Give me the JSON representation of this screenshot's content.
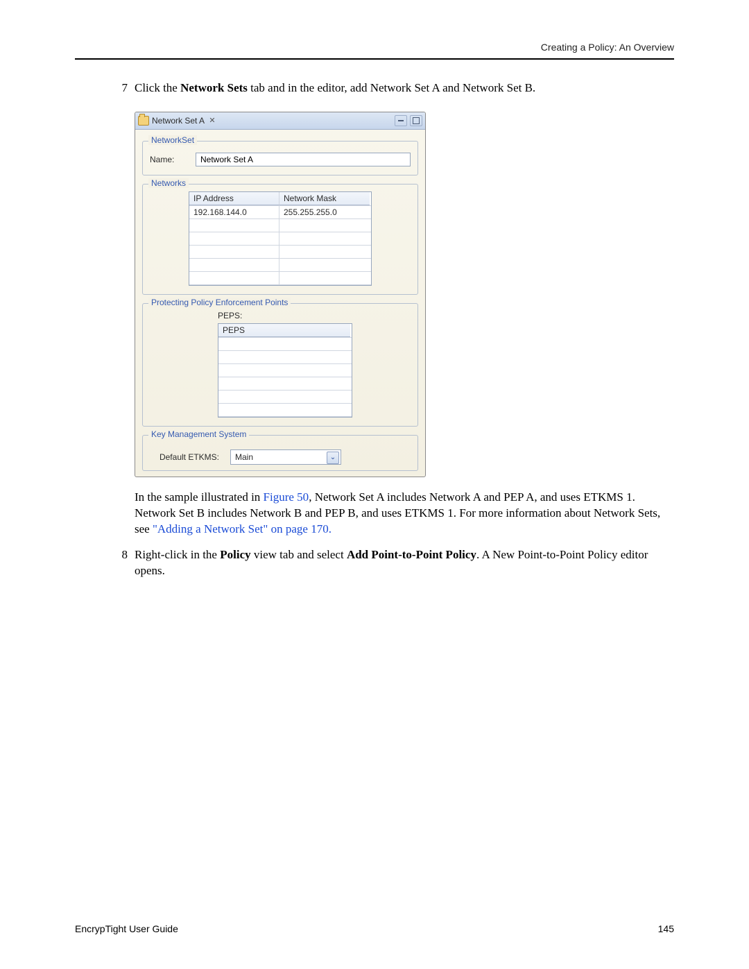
{
  "header": {
    "running_head": "Creating a Policy: An Overview"
  },
  "steps": {
    "seven": {
      "marker": "7",
      "prefix": "Click the ",
      "bold": "Network Sets",
      "suffix": " tab and in the editor, add Network Set A and Network Set B."
    },
    "eight": {
      "marker": "8",
      "prefix": "Right-click in the ",
      "bold1": "Policy",
      "mid": " view tab and select ",
      "bold2": "Add Point-to-Point Policy",
      "suffix": ". A New Point-to-Point Policy editor opens."
    }
  },
  "paragraph": {
    "prefix": "In the sample illustrated in ",
    "link1": "Figure 50",
    "mid": ", Network Set A includes Network A and PEP A, and uses ETKMS 1. Network Set B includes Network B and PEP B, and uses ETKMS 1. For more information about Network Sets, see ",
    "link2": "\"Adding a Network Set\" on page 170.",
    "suffix": ""
  },
  "window": {
    "title": "Network Set A",
    "close_glyph": "✕",
    "groups": {
      "networkset": {
        "legend": "NetworkSet",
        "name_label": "Name:",
        "name_value": "Network Set A"
      },
      "networks": {
        "legend": "Networks",
        "headers": {
          "ip": "IP Address",
          "mask": "Network Mask"
        },
        "rows": [
          {
            "ip": "192.168.144.0",
            "mask": "255.255.255.0"
          },
          {
            "ip": "",
            "mask": ""
          },
          {
            "ip": "",
            "mask": ""
          },
          {
            "ip": "",
            "mask": ""
          },
          {
            "ip": "",
            "mask": ""
          },
          {
            "ip": "",
            "mask": ""
          }
        ]
      },
      "peps": {
        "legend": "Protecting Policy Enforcement Points",
        "label": "PEPS:",
        "header": "PEPS",
        "blank": ""
      },
      "kms": {
        "legend": "Key Management System",
        "label": "Default ETKMS:",
        "value": "Main",
        "caret": "⌄"
      }
    }
  },
  "footer": {
    "left": "EncrypTight User Guide",
    "right": "145"
  }
}
